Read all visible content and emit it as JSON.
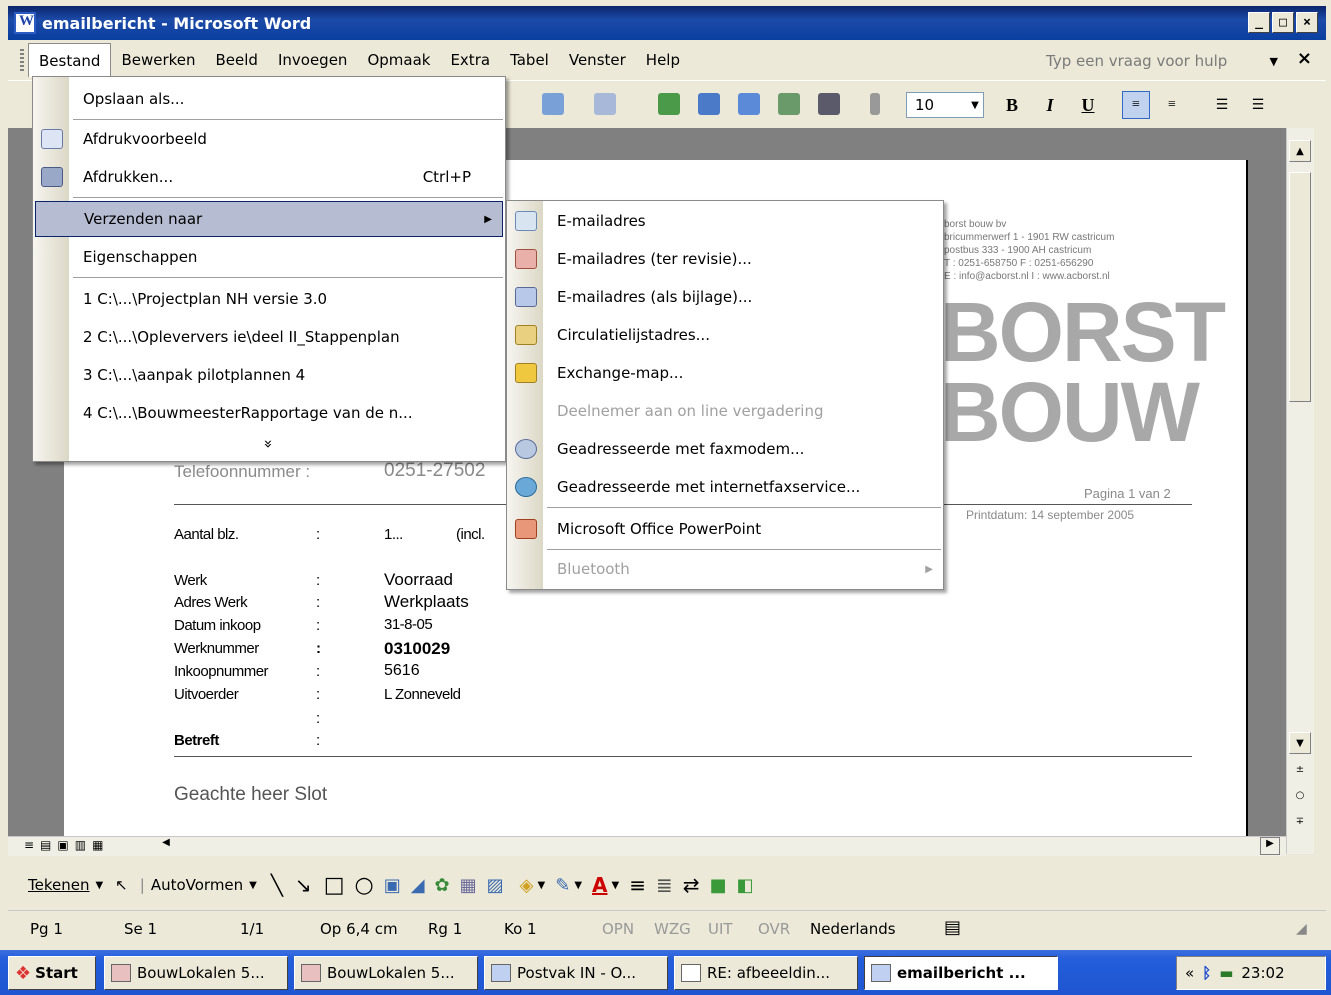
{
  "window": {
    "title": "emailbericht - Microsoft Word"
  },
  "menubar": {
    "items": [
      "Bestand",
      "Bewerken",
      "Beeld",
      "Invoegen",
      "Opmaak",
      "Extra",
      "Tabel",
      "Venster",
      "Help"
    ],
    "help_placeholder": "Typ een vraag voor hulp"
  },
  "toolbar": {
    "font_size": "10"
  },
  "file_menu": {
    "items": [
      {
        "label": "Opslaan als..."
      },
      {
        "label": "Afdrukvoorbeeld"
      },
      {
        "label": "Afdrukken...",
        "shortcut": "Ctrl+P"
      },
      {
        "label": "Verzenden naar"
      },
      {
        "label": "Eigenschappen"
      },
      {
        "label": "1 C:\\...\\Projectplan NH versie 3.0"
      },
      {
        "label": "2 C:\\...\\Opleververs ie\\deel II_Stappenplan"
      },
      {
        "label": "3 C:\\...\\aanpak pilotplannen 4"
      },
      {
        "label": "4 C:\\...\\BouwmeesterRapportage van de n..."
      }
    ],
    "expand": "»"
  },
  "send_menu": {
    "items": [
      {
        "label": "E-mailadres"
      },
      {
        "label": "E-mailadres (ter revisie)..."
      },
      {
        "label": "E-mailadres (als bijlage)..."
      },
      {
        "label": "Circulatielijstadres..."
      },
      {
        "label": "Exchange-map..."
      },
      {
        "label": "Deelnemer aan on line vergadering"
      },
      {
        "label": "Geadresseerde met faxmodem..."
      },
      {
        "label": "Geadresseerde met internetfaxservice..."
      },
      {
        "label": "Microsoft Office PowerPoint"
      },
      {
        "label": "Bluetooth"
      }
    ]
  },
  "document": {
    "company": {
      "name": "borst bouw bv",
      "address": "bricummerwerf 1 - 1901 RW castricum",
      "postbus": "postbus 333 - 1900 AH castricum",
      "phone": "T : 0251-658750    F : 0251-656290",
      "web": "E : info@acborst.nl   I : www.acborst.nl",
      "logo1": "BORST",
      "logo2": "BOUW"
    },
    "page_info": "Pagina 1 van 2",
    "print_date": "Printdatum: 14 september 2005",
    "telefoon_label": "Telefoonnummer :",
    "telefoon_value": "0251-27502",
    "aantal_label": "Aantal blz.",
    "aantal_value": "1...",
    "aantal_extra": "(incl.",
    "fields": [
      {
        "label": "Werk",
        "value": "Voorraad"
      },
      {
        "label": "Adres Werk",
        "value": "Werkplaats"
      },
      {
        "label": "Datum inkoop",
        "value": "31-8-05"
      },
      {
        "label": "Werknummer",
        "value": "0310029"
      },
      {
        "label": "Inkoopnummer",
        "value": "5616"
      },
      {
        "label": "Uitvoerder",
        "value": "L Zonneveld"
      }
    ],
    "betreft_label": "Betreft",
    "colon": ":",
    "greeting": "Geachte heer Slot"
  },
  "drawbar": {
    "tekenen": "Tekenen",
    "autovormen": "AutoVormen"
  },
  "statusbar": {
    "pg": "Pg 1",
    "se": "Se 1",
    "pages": "1/1",
    "op": "Op 6,4 cm",
    "rg": "Rg 1",
    "ko": "Ko 1",
    "opn": "OPN",
    "wzg": "WZG",
    "uit": "UIT",
    "ovr": "OVR",
    "language": "Nederlands"
  },
  "taskbar": {
    "start": "Start",
    "buttons": [
      "BouwLokalen 5...",
      "BouwLokalen 5...",
      "Postvak IN - O...",
      "RE: afbeeeldin...",
      "emailbericht ..."
    ],
    "clock": "23:02"
  },
  "colors": {
    "title_bar": "#0a246a",
    "highlight": "#b6bdd2",
    "taskbar": "#245edb"
  }
}
